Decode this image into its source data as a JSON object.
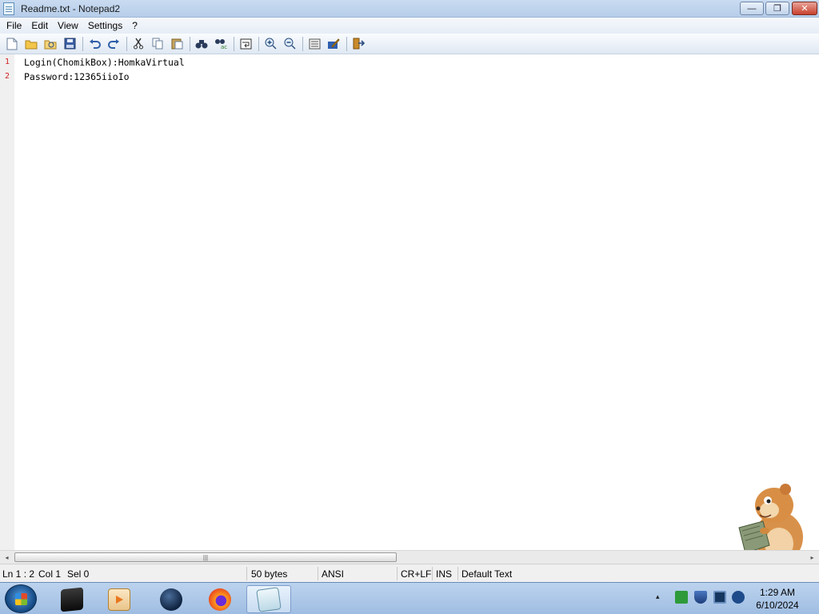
{
  "window": {
    "title": "Readme.txt - Notepad2",
    "buttons": {
      "minimize": "—",
      "maximize": "❐",
      "close": "✕"
    }
  },
  "menu": [
    {
      "label": "File"
    },
    {
      "label": "Edit"
    },
    {
      "label": "View"
    },
    {
      "label": "Settings"
    },
    {
      "label": "?"
    }
  ],
  "toolbar": {
    "icons": [
      "new-file-icon",
      "open-folder-icon",
      "browse-icon",
      "save-icon",
      "undo-icon",
      "redo-icon",
      "cut-icon",
      "copy-icon",
      "paste-icon",
      "find-icon",
      "replace-icon",
      "word-wrap-icon",
      "zoom-in-icon",
      "zoom-out-icon",
      "select-scheme-icon",
      "customize-scheme-icon",
      "exit-icon"
    ]
  },
  "editor": {
    "lines": [
      {
        "number": "1",
        "text": "Login(ChomikBox):HomkaVirtual"
      },
      {
        "number": "2",
        "text": "Password:12365iioIo"
      }
    ]
  },
  "scrollbar": {
    "left_arrow": "◂",
    "right_arrow": "▸",
    "grip": "|||"
  },
  "status": {
    "position": "Ln 1 : 2",
    "column": "Col 1",
    "selection": "Sel 0",
    "size": "50 bytes",
    "encoding": "ANSI",
    "line_ending": "CR+LF",
    "mode": "INS",
    "scheme": "Default Text"
  },
  "taskbar": {
    "apps": [
      "terminal-icon",
      "media-player-icon",
      "browser-globe-icon",
      "firefox-icon",
      "notepad2-icon"
    ],
    "tray": [
      "tray-expand-icon",
      "sync-icon",
      "security-shield-icon",
      "network-icon",
      "volume-icon"
    ],
    "tray_expand": "▴",
    "time": "1:29 AM",
    "date": "6/10/2024"
  },
  "colors": {
    "line_number": "#d02020",
    "titlebar": "#c9dbf1",
    "taskbar": "#a9c5e8"
  }
}
